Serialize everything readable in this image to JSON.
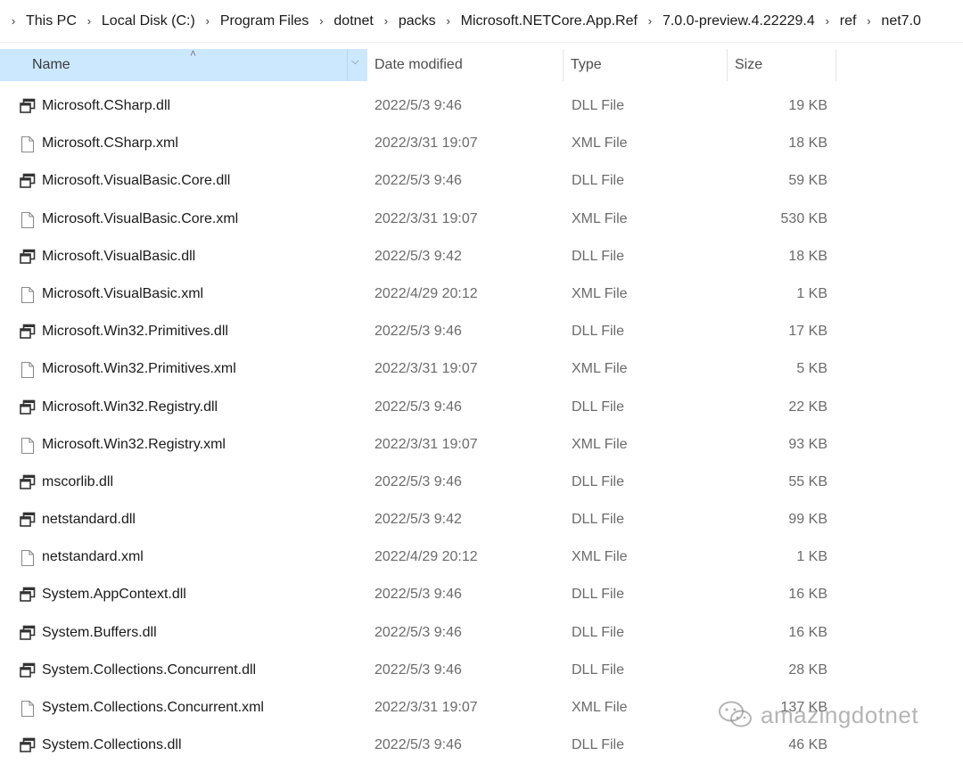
{
  "breadcrumb": [
    "This PC",
    "Local Disk (C:)",
    "Program Files",
    "dotnet",
    "packs",
    "Microsoft.NETCore.App.Ref",
    "7.0.0-preview.4.22229.4",
    "ref",
    "net7.0"
  ],
  "columns": {
    "name": "Name",
    "date": "Date modified",
    "type": "Type",
    "size": "Size"
  },
  "files": [
    {
      "name": "Microsoft.CSharp.dll",
      "date": "2022/5/3 9:46",
      "type": "DLL File",
      "size": "19 KB",
      "icon": "dll-icon"
    },
    {
      "name": "Microsoft.CSharp.xml",
      "date": "2022/3/31 19:07",
      "type": "XML File",
      "size": "18 KB",
      "icon": "file-icon"
    },
    {
      "name": "Microsoft.VisualBasic.Core.dll",
      "date": "2022/5/3 9:46",
      "type": "DLL File",
      "size": "59 KB",
      "icon": "dll-icon"
    },
    {
      "name": "Microsoft.VisualBasic.Core.xml",
      "date": "2022/3/31 19:07",
      "type": "XML File",
      "size": "530 KB",
      "icon": "file-icon"
    },
    {
      "name": "Microsoft.VisualBasic.dll",
      "date": "2022/5/3 9:42",
      "type": "DLL File",
      "size": "18 KB",
      "icon": "dll-icon"
    },
    {
      "name": "Microsoft.VisualBasic.xml",
      "date": "2022/4/29 20:12",
      "type": "XML File",
      "size": "1 KB",
      "icon": "file-icon"
    },
    {
      "name": "Microsoft.Win32.Primitives.dll",
      "date": "2022/5/3 9:46",
      "type": "DLL File",
      "size": "17 KB",
      "icon": "dll-icon"
    },
    {
      "name": "Microsoft.Win32.Primitives.xml",
      "date": "2022/3/31 19:07",
      "type": "XML File",
      "size": "5 KB",
      "icon": "file-icon"
    },
    {
      "name": "Microsoft.Win32.Registry.dll",
      "date": "2022/5/3 9:46",
      "type": "DLL File",
      "size": "22 KB",
      "icon": "dll-icon"
    },
    {
      "name": "Microsoft.Win32.Registry.xml",
      "date": "2022/3/31 19:07",
      "type": "XML File",
      "size": "93 KB",
      "icon": "file-icon"
    },
    {
      "name": "mscorlib.dll",
      "date": "2022/5/3 9:46",
      "type": "DLL File",
      "size": "55 KB",
      "icon": "dll-icon"
    },
    {
      "name": "netstandard.dll",
      "date": "2022/5/3 9:42",
      "type": "DLL File",
      "size": "99 KB",
      "icon": "dll-icon"
    },
    {
      "name": "netstandard.xml",
      "date": "2022/4/29 20:12",
      "type": "XML File",
      "size": "1 KB",
      "icon": "file-icon"
    },
    {
      "name": "System.AppContext.dll",
      "date": "2022/5/3 9:46",
      "type": "DLL File",
      "size": "16 KB",
      "icon": "dll-icon"
    },
    {
      "name": "System.Buffers.dll",
      "date": "2022/5/3 9:46",
      "type": "DLL File",
      "size": "16 KB",
      "icon": "dll-icon"
    },
    {
      "name": "System.Collections.Concurrent.dll",
      "date": "2022/5/3 9:46",
      "type": "DLL File",
      "size": "28 KB",
      "icon": "dll-icon"
    },
    {
      "name": "System.Collections.Concurrent.xml",
      "date": "2022/3/31 19:07",
      "type": "XML File",
      "size": "137 KB",
      "icon": "file-icon"
    },
    {
      "name": "System.Collections.dll",
      "date": "2022/5/3 9:46",
      "type": "DLL File",
      "size": "46 KB",
      "icon": "dll-icon"
    }
  ],
  "watermark": {
    "text": "amazingdotnet",
    "icon": "wechat-icon"
  },
  "colors": {
    "header_selected": "#cce8ff",
    "muted_text": "#6b6b6b"
  }
}
